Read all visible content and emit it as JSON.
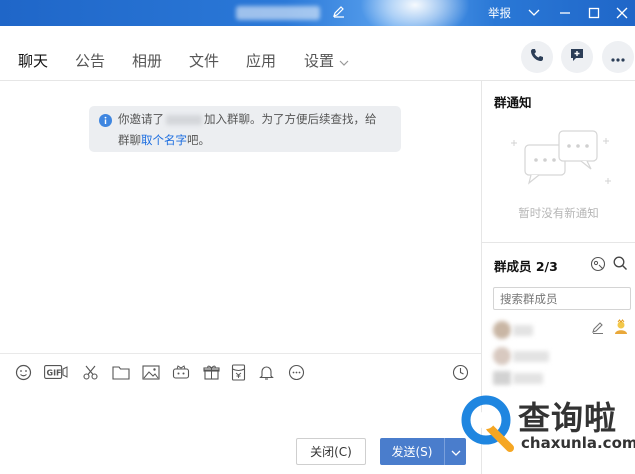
{
  "titlebar": {
    "report_label": "举报"
  },
  "tabs": [
    {
      "label": "聊天"
    },
    {
      "label": "公告"
    },
    {
      "label": "相册"
    },
    {
      "label": "文件"
    },
    {
      "label": "应用"
    },
    {
      "label": "设置"
    }
  ],
  "notice": {
    "part1": "你邀请了",
    "part2": "加入群聊。为了方便后续查找，给",
    "part3": "群聊",
    "link": "取个名字",
    "part4": "吧。"
  },
  "group_notice": {
    "title": "群通知",
    "empty_text": "暂时没有新通知"
  },
  "members": {
    "title": "群成员 2/3",
    "search_placeholder": "搜索群成员"
  },
  "buttons": {
    "close_label": "关闭(C)",
    "send_label": "发送(S)"
  },
  "watermark": {
    "text": "查询啦",
    "url": "chaxunla.com"
  },
  "colors": {
    "titlebar": "#2b79d8",
    "send_button": "#4a7dcc",
    "link": "#1d6ee0",
    "watermark_blue": "#1f86e0",
    "watermark_orange": "#f5a623"
  }
}
